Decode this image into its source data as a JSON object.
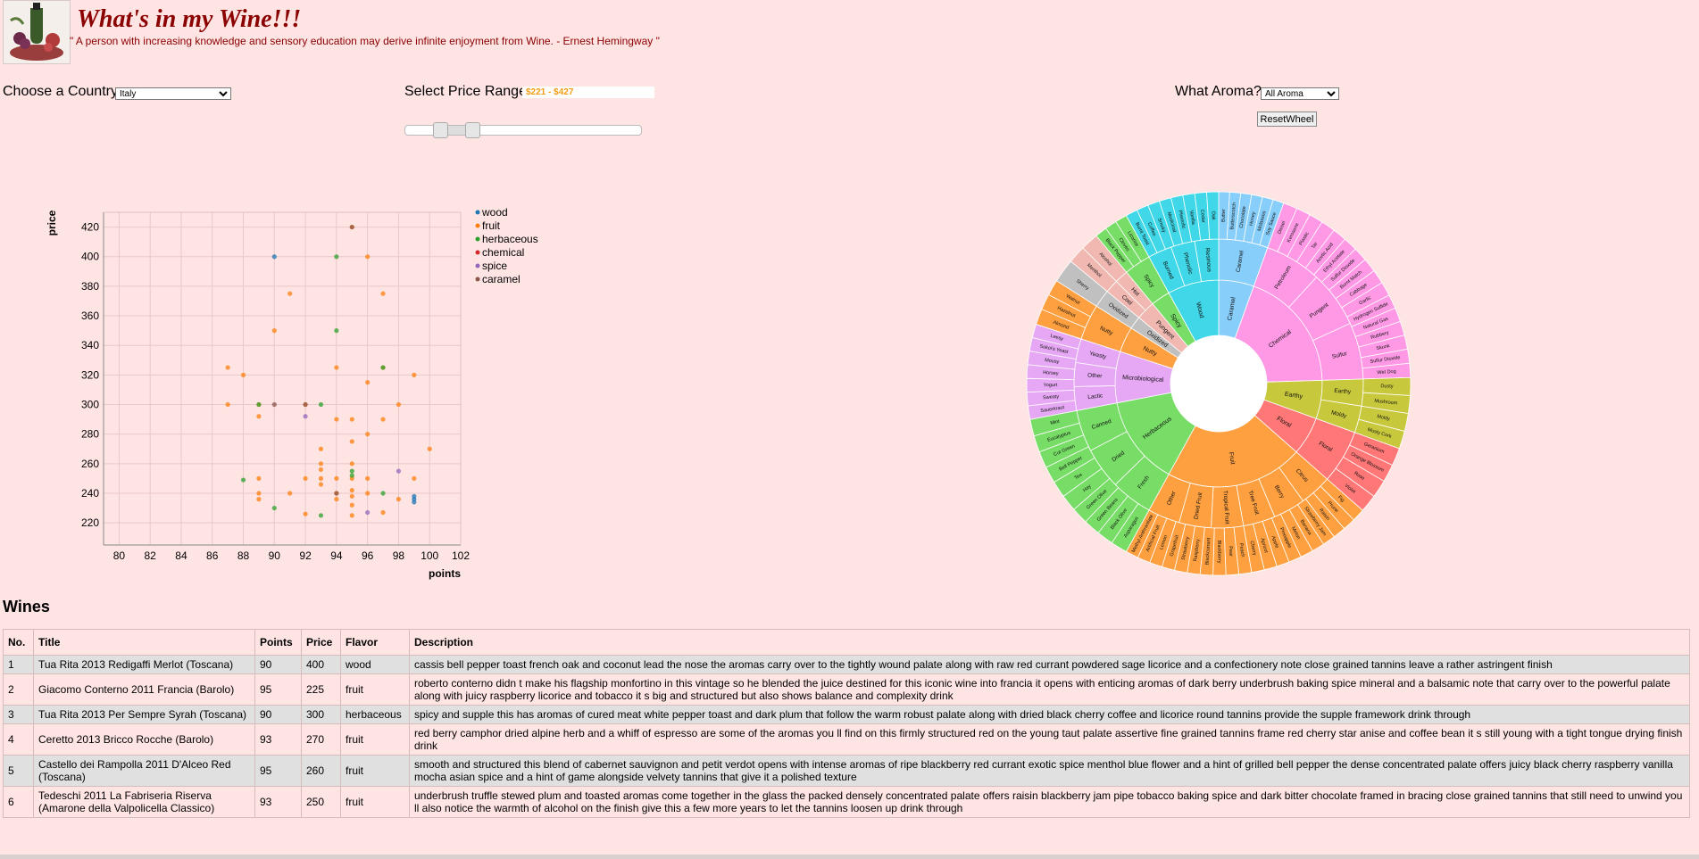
{
  "header": {
    "title": "What's in my Wine!!!",
    "quote": "\" A person with increasing knowledge and sensory education may derive infinite enjoyment from Wine. - Ernest Hemingway \""
  },
  "controls": {
    "country_label": "Choose a Country:",
    "country_value": "Italy",
    "price_label": "Select Price Range:",
    "price_value": "$221 - $427",
    "price_min": 221,
    "price_max": 427,
    "aroma_label": "What Aroma?:",
    "aroma_value": "All Aroma",
    "reset_label": "ResetWheel"
  },
  "colors": {
    "wood": "#1f77b4",
    "fruit": "#ff7f0e",
    "herbaceous": "#2ca02c",
    "chemical": "#d62728",
    "spice": "#9467bd",
    "caramel": "#8c564b"
  },
  "chart_data": [
    {
      "type": "scatter",
      "xlabel": "points",
      "ylabel": "price",
      "xlim": [
        79,
        102
      ],
      "ylim": [
        205,
        430
      ],
      "x_ticks": [
        80,
        82,
        84,
        86,
        88,
        90,
        92,
        94,
        96,
        98,
        100,
        102
      ],
      "y_ticks": [
        220,
        240,
        260,
        280,
        300,
        320,
        340,
        360,
        380,
        400,
        420
      ],
      "grid": true,
      "legend_position": "right",
      "legend": [
        "wood",
        "fruit",
        "herbaceous",
        "chemical",
        "spice",
        "caramel"
      ],
      "series": [
        {
          "name": "wood",
          "points": [
            [
              90,
              400
            ],
            [
              99,
              236
            ],
            [
              99,
              238
            ],
            [
              99,
              234
            ]
          ]
        },
        {
          "name": "fruit",
          "points": [
            [
              87,
              325
            ],
            [
              87,
              300
            ],
            [
              88,
              320
            ],
            [
              89,
              300
            ],
            [
              89,
              292
            ],
            [
              89,
              250
            ],
            [
              89,
              240
            ],
            [
              89,
              236
            ],
            [
              91,
              375
            ],
            [
              91,
              240
            ],
            [
              90,
              350
            ],
            [
              92,
              300
            ],
            [
              92,
              250
            ],
            [
              92,
              226
            ],
            [
              93,
              270
            ],
            [
              93,
              260
            ],
            [
              93,
              256
            ],
            [
              93,
              250
            ],
            [
              93,
              246
            ],
            [
              94,
              325
            ],
            [
              94,
              290
            ],
            [
              94,
              250
            ],
            [
              94,
              240
            ],
            [
              94,
              236
            ],
            [
              95,
              420
            ],
            [
              95,
              290
            ],
            [
              95,
              275
            ],
            [
              95,
              260
            ],
            [
              95,
              250
            ],
            [
              95,
              242
            ],
            [
              95,
              238
            ],
            [
              95,
              232
            ],
            [
              95,
              225
            ],
            [
              96,
              400
            ],
            [
              96,
              315
            ],
            [
              96,
              280
            ],
            [
              96,
              250
            ],
            [
              96,
              240
            ],
            [
              97,
              375
            ],
            [
              97,
              325
            ],
            [
              97,
              290
            ],
            [
              97,
              227
            ],
            [
              98,
              300
            ],
            [
              98,
              236
            ],
            [
              99,
              320
            ],
            [
              99,
              250
            ],
            [
              100,
              270
            ]
          ]
        },
        {
          "name": "herbaceous",
          "points": [
            [
              88,
              249
            ],
            [
              89,
              300
            ],
            [
              90,
              230
            ],
            [
              93,
              300
            ],
            [
              93,
              225
            ],
            [
              94,
              400
            ],
            [
              94,
              350
            ],
            [
              95,
              255
            ],
            [
              95,
              252
            ],
            [
              97,
              325
            ],
            [
              97,
              240
            ]
          ]
        },
        {
          "name": "chemical",
          "points": []
        },
        {
          "name": "spice",
          "points": [
            [
              92,
              292
            ],
            [
              96,
              227
            ],
            [
              98,
              255
            ]
          ]
        },
        {
          "name": "caramel",
          "points": [
            [
              90,
              300
            ],
            [
              92,
              300
            ],
            [
              94,
              240
            ],
            [
              95,
              420
            ]
          ]
        }
      ]
    },
    {
      "type": "sunburst",
      "title": "",
      "inner_ring": [
        {
          "name": "Caramel",
          "color": "#87cefa",
          "share": 0.055
        },
        {
          "name": "Chemical",
          "color": "#ff99e6",
          "share": 0.19
        },
        {
          "name": "Earthy",
          "color": "#c8c83c",
          "share": 0.06
        },
        {
          "name": "Floral",
          "color": "#ff7777",
          "share": 0.06
        },
        {
          "name": "Fruit",
          "color": "#ffa040",
          "share": 0.215
        },
        {
          "name": "Herbaceous",
          "color": "#77dd66",
          "share": 0.14
        },
        {
          "name": "Microbiological",
          "color": "#e6a8f5",
          "share": 0.08
        },
        {
          "name": "Nutty",
          "color": "#ffa040",
          "share": 0.04
        },
        {
          "name": "Oxidized",
          "color": "#c0c0c0",
          "share": 0.02
        },
        {
          "name": "Pungent",
          "color": "#f0b8b0",
          "share": 0.03
        },
        {
          "name": "Spicy",
          "color": "#77dd66",
          "share": 0.03
        },
        {
          "name": "Wood",
          "color": "#40d8e8",
          "share": 0.08
        }
      ],
      "middle_ring": [
        {
          "parent": "Caramel",
          "name": "Caramel"
        },
        {
          "parent": "Chemical",
          "name": "Petroleum"
        },
        {
          "parent": "Chemical",
          "name": "Pungent"
        },
        {
          "parent": "Chemical",
          "name": "Sulfur"
        },
        {
          "parent": "Earthy",
          "name": "Earthy"
        },
        {
          "parent": "Earthy",
          "name": "Moldy"
        },
        {
          "parent": "Floral",
          "name": "Floral"
        },
        {
          "parent": "Fruit",
          "name": "Citrus"
        },
        {
          "parent": "Fruit",
          "name": "Berry"
        },
        {
          "parent": "Fruit",
          "name": "Tree Fruit"
        },
        {
          "parent": "Fruit",
          "name": "Tropical Fruit"
        },
        {
          "parent": "Fruit",
          "name": "Dried Fruit"
        },
        {
          "parent": "Fruit",
          "name": "Other"
        },
        {
          "parent": "Herbaceous",
          "name": "Fresh"
        },
        {
          "parent": "Herbaceous",
          "name": "Dried"
        },
        {
          "parent": "Herbaceous",
          "name": "Canned"
        },
        {
          "parent": "Microbiological",
          "name": "Lactic"
        },
        {
          "parent": "Microbiological",
          "name": "Other"
        },
        {
          "parent": "Microbiological",
          "name": "Yeasty"
        },
        {
          "parent": "Nutty",
          "name": "Nutty"
        },
        {
          "parent": "Oxidized",
          "name": "Oxidized"
        },
        {
          "parent": "Pungent",
          "name": "Cool"
        },
        {
          "parent": "Pungent",
          "name": "Hot"
        },
        {
          "parent": "Spicy",
          "name": "Spicy"
        },
        {
          "parent": "Wood",
          "name": "Burned"
        },
        {
          "parent": "Wood",
          "name": "Phenolic"
        },
        {
          "parent": "Wood",
          "name": "Resinous"
        }
      ],
      "outer_ring": [
        {
          "parent": "Caramel",
          "items": [
            "Butter",
            "Butterscotch",
            "Chocolate",
            "Honey",
            "Molasses",
            "Soy Sauce"
          ]
        },
        {
          "parent": "Chemical",
          "items": [
            "Diesel",
            "Kerosene",
            "Plastic",
            "Tar",
            "Acetic Acid",
            "Ethyl Acetate",
            "Sulfur Dioxide",
            "Burnt Match",
            "Cabbage",
            "Garlic",
            "Hydrogen Sulfide",
            "Natural Gas",
            "Rubbery",
            "Skunk",
            "Sulfur Dioxide",
            "Wet Dog"
          ]
        },
        {
          "parent": "Earthy",
          "items": [
            "Dusty",
            "Mushroom",
            "Moldy",
            "Musty Cork"
          ]
        },
        {
          "parent": "Floral",
          "items": [
            "Geranium",
            "Orange Blossom",
            "Rose",
            "Violet"
          ]
        },
        {
          "parent": "Fruit",
          "items": [
            "Fig",
            "Prune",
            "Raisin",
            "Strawberry Jam",
            "Banana",
            "Melon",
            "Pineapple",
            "Apple",
            "Apricot",
            "Cherry",
            "Peach",
            "Pear",
            "Blackberry",
            "Blackcurrant",
            "Raspberry",
            "Strawberry",
            "Grapefruit",
            "Lemon",
            "Artificial Fruit",
            "Methyl Anthranilate"
          ]
        },
        {
          "parent": "Herbaceous",
          "items": [
            "Asparagus",
            "Black Olive",
            "Green Beans",
            "Green Olive",
            "Hay",
            "Tea",
            "Bell Pepper",
            "Cut Green",
            "Eucalyptus",
            "Mint"
          ]
        },
        {
          "parent": "Microbiological",
          "items": [
            "Sauerkraut",
            "Sweaty",
            "Yogurt",
            "Horsey",
            "Mousy",
            "Sokoi's Yeast",
            "Leesy"
          ]
        },
        {
          "parent": "Nutty",
          "items": [
            "Almond",
            "Hazelnut",
            "Walnut"
          ]
        },
        {
          "parent": "Oxidized",
          "items": [
            "Sherry"
          ]
        },
        {
          "parent": "Pungent",
          "items": [
            "Menthol",
            "Alcohol"
          ]
        },
        {
          "parent": "Spicy",
          "items": [
            "Black Pepper",
            "Cloves",
            "Licorice"
          ]
        },
        {
          "parent": "Wood",
          "items": [
            "Burnt Toast",
            "Coffee",
            "Smoky",
            "Medicinal",
            "Phenolic",
            "Vanilla",
            "Cedar",
            "Oak"
          ]
        }
      ]
    }
  ],
  "wines": {
    "heading": "Wines",
    "columns": [
      "No.",
      "Title",
      "Points",
      "Price",
      "Flavor",
      "Description"
    ],
    "rows": [
      [
        "1",
        "Tua Rita 2013 Redigaffi Merlot (Toscana)",
        "90",
        "400",
        "wood",
        "cassis bell pepper toast french oak and coconut lead the nose the aromas carry over to the tightly wound palate along with raw red currant powdered sage licorice and a confectionery note close grained tannins leave a rather astringent finish"
      ],
      [
        "2",
        "Giacomo Conterno 2011 Francia (Barolo)",
        "95",
        "225",
        "fruit",
        "roberto conterno didn t make his flagship monfortino in this vintage so he blended the juice destined for this iconic wine into francia it opens with enticing aromas of dark berry underbrush baking spice mineral and a balsamic note that carry over to the powerful palate along with juicy raspberry licorice and tobacco it s big and structured but also shows balance and complexity drink"
      ],
      [
        "3",
        "Tua Rita 2013 Per Sempre Syrah (Toscana)",
        "90",
        "300",
        "herbaceous",
        "spicy and supple this has aromas of cured meat white pepper toast and dark plum that follow the warm robust palate along with dried black cherry coffee and licorice round tannins provide the supple framework drink through"
      ],
      [
        "4",
        "Ceretto 2013 Bricco Rocche (Barolo)",
        "93",
        "270",
        "fruit",
        "red berry camphor dried alpine herb and a whiff of espresso are some of the aromas you ll find on this firmly structured red on the young taut palate assertive fine grained tannins frame red cherry star anise and coffee bean it s still young with a tight tongue drying finish drink"
      ],
      [
        "5",
        "Castello dei Rampolla 2011 D'Alceo Red (Toscana)",
        "95",
        "260",
        "fruit",
        "smooth and structured this blend of cabernet sauvignon and petit verdot opens with intense aromas of ripe blackberry red currant exotic spice menthol blue flower and a hint of grilled bell pepper the dense concentrated palate offers juicy black cherry raspberry vanilla mocha asian spice and a hint of game alongside velvety tannins that give it a polished texture"
      ],
      [
        "6",
        "Tedeschi 2011 La Fabriseria Riserva (Amarone della Valpolicella Classico)",
        "93",
        "250",
        "fruit",
        "underbrush truffle stewed plum and toasted aromas come together in the glass the packed densely concentrated palate offers raisin blackberry jam pipe tobacco baking spice and dark bitter chocolate framed in bracing close grained tannins that still need to unwind you ll also notice the warmth of alcohol on the finish give this a few more years to let the tannins loosen up drink through"
      ]
    ]
  }
}
